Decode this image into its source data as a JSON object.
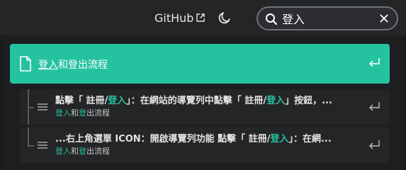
{
  "navbar": {
    "github_label": "GitHub"
  },
  "search": {
    "value": "登入",
    "placeholder": ""
  },
  "results": {
    "primary": {
      "title_highlight": "登入",
      "title_rest": "和登出流程"
    },
    "hits": [
      {
        "main_parts": [
          "點擊「 註冊/",
          "登入",
          "」：在網站的導覽列中點擊「 註冊/",
          "登入",
          "」按鈕，..."
        ],
        "crumb_parts": [
          "登入",
          "和",
          "登",
          "出流程"
        ]
      },
      {
        "main_parts": [
          "...右上角選單 ICON：開啟導覽列功能 點擊「 註冊/",
          "登入",
          "」：在網..."
        ],
        "crumb_parts": [
          "登入",
          "和",
          "登",
          "出流程"
        ]
      }
    ]
  },
  "colors": {
    "accent": "#25c2a0",
    "background": "#1b1b1d",
    "navbar": "#242526"
  },
  "icons": [
    "external-link-icon",
    "moon-icon",
    "search-icon",
    "close-icon",
    "document-icon",
    "enter-icon",
    "lines-icon"
  ]
}
